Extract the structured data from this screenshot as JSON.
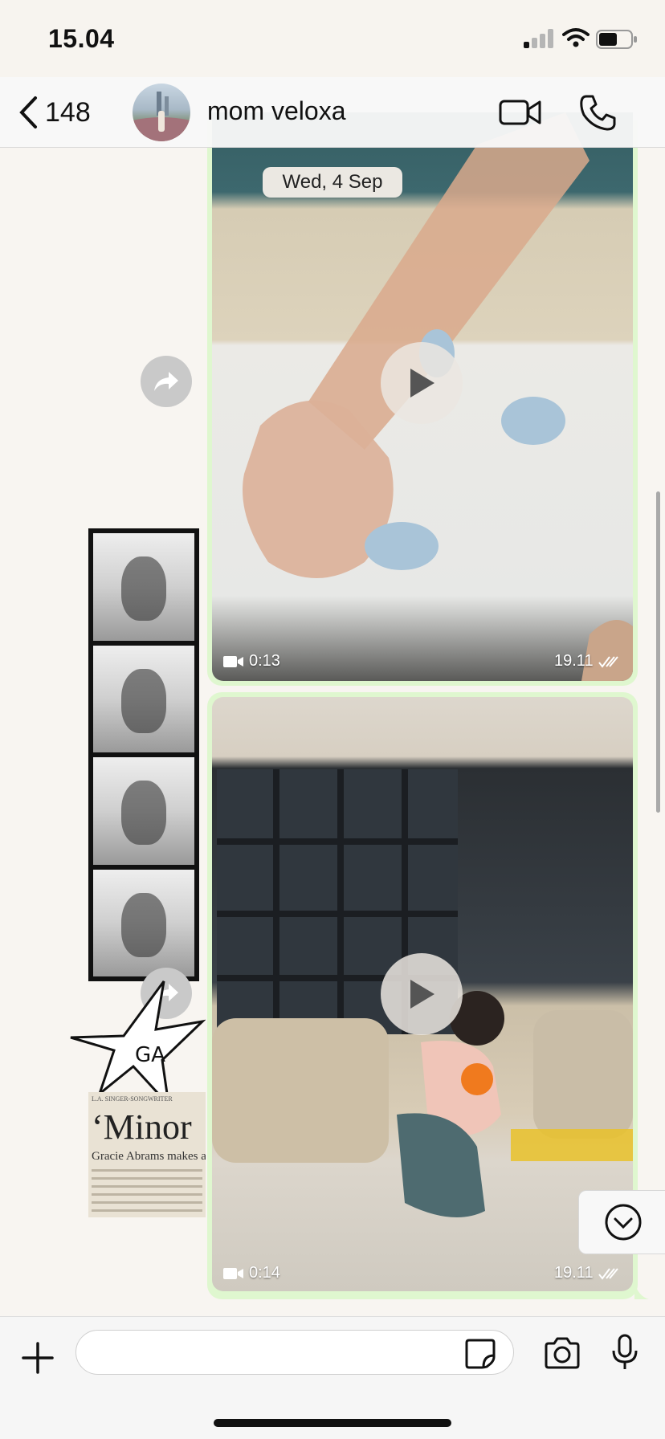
{
  "status_bar": {
    "time": "15.04",
    "icons": [
      "cellular-signal-icon",
      "wifi-icon",
      "battery-icon"
    ]
  },
  "header": {
    "back_count": "148",
    "contact_name": "mom veloxa",
    "actions": [
      "video-call-icon",
      "phone-icon"
    ]
  },
  "chat": {
    "date_label": "Wed, 4 Sep",
    "messages": [
      {
        "type": "video",
        "duration": "0:13",
        "time": "19.11",
        "status": "read"
      },
      {
        "type": "video",
        "duration": "0:14",
        "time": "19.11",
        "status": "read"
      }
    ],
    "sticker_text": {
      "star": "GA",
      "clipping_header": "L.A. SINGER-SONGWRITER",
      "clipping_title": "‘Minor",
      "clipping_subtitle": "Gracie Abrams makes a"
    }
  },
  "input": {
    "placeholder": "",
    "value": ""
  },
  "colors": {
    "bubble_outgoing": "#dff7cf",
    "chat_background": "#f8f5f1",
    "header_background": "#f8f8f8"
  }
}
